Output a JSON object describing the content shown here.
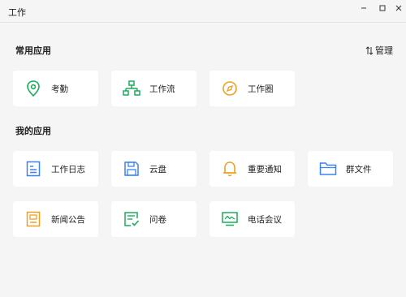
{
  "window": {
    "title": "工作"
  },
  "sections": {
    "common": {
      "title": "常用应用",
      "manage_label": "管理"
    },
    "mine": {
      "title": "我的应用"
    }
  },
  "common_apps": [
    {
      "label": "考勤",
      "icon": "location-pin-icon",
      "color": "#1aad5a"
    },
    {
      "label": "工作流",
      "icon": "workflow-icon",
      "color": "#1aad5a"
    },
    {
      "label": "工作圈",
      "icon": "compass-icon",
      "color": "#f0a020"
    }
  ],
  "my_apps": [
    {
      "label": "工作日志",
      "icon": "document-icon",
      "color": "#3b82f6"
    },
    {
      "label": "云盘",
      "icon": "disk-icon",
      "color": "#3b82f6"
    },
    {
      "label": "重要通知",
      "icon": "bell-icon",
      "color": "#f0a020"
    },
    {
      "label": "群文件",
      "icon": "folder-icon",
      "color": "#3b82f6"
    },
    {
      "label": "新闻公告",
      "icon": "news-icon",
      "color": "#f0a020"
    },
    {
      "label": "问卷",
      "icon": "survey-icon",
      "color": "#1aad5a"
    },
    {
      "label": "电话会议",
      "icon": "monitor-icon",
      "color": "#1aad5a"
    }
  ]
}
